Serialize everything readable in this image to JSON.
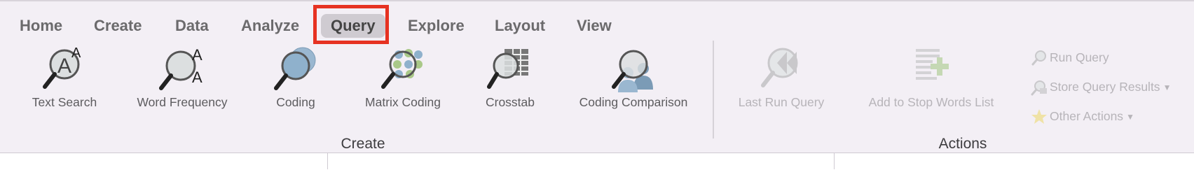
{
  "tabs": [
    {
      "label": "Home"
    },
    {
      "label": "Create"
    },
    {
      "label": "Data"
    },
    {
      "label": "Analyze"
    },
    {
      "label": "Query"
    },
    {
      "label": "Explore"
    },
    {
      "label": "Layout"
    },
    {
      "label": "View"
    }
  ],
  "active_tab": "Query",
  "accent_color": "#e63222",
  "create_group": {
    "label": "Create",
    "buttons": [
      {
        "label": "Text Search",
        "icon": "text-search-icon"
      },
      {
        "label": "Word Frequency",
        "icon": "word-frequency-icon"
      },
      {
        "label": "Coding",
        "icon": "coding-query-icon"
      },
      {
        "label": "Matrix Coding",
        "icon": "matrix-coding-icon"
      },
      {
        "label": "Crosstab",
        "icon": "crosstab-icon"
      },
      {
        "label": "Coding Comparison",
        "icon": "coding-comparison-icon"
      }
    ]
  },
  "actions_group": {
    "label": "Actions",
    "buttons": [
      {
        "label": "Last Run Query",
        "icon": "last-run-query-icon",
        "enabled": false
      },
      {
        "label": "Add to Stop Words List",
        "icon": "add-stop-words-icon",
        "enabled": false
      }
    ],
    "small_buttons": [
      {
        "label": "Run Query",
        "icon": "run-query-icon",
        "enabled": false
      },
      {
        "label": "Store Query Results",
        "icon": "store-query-results-icon",
        "enabled": false,
        "dropdown": true
      },
      {
        "label": "Other Actions",
        "icon": "star-icon",
        "enabled": false,
        "dropdown": true
      }
    ]
  }
}
